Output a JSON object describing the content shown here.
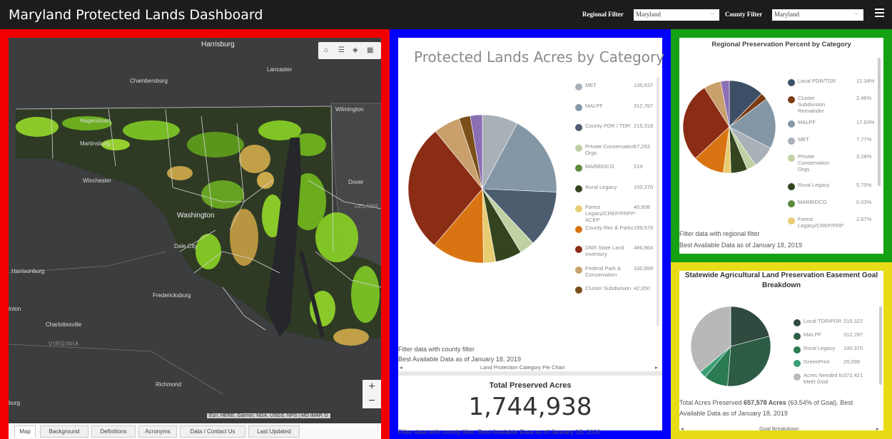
{
  "header": {
    "title": "Maryland Protected Lands Dashboard",
    "regional_filter_label": "Regional Filter",
    "regional_filter_value": "Maryland",
    "county_filter_label": "County Filter",
    "county_filter_value": "Maryland"
  },
  "colors": {
    "red_frame": "#f20000",
    "blue_frame": "#0000ff",
    "green_frame": "#14a214",
    "yellow_frame": "#e8dc16",
    "header_bg": "#1c1c1c"
  },
  "map": {
    "labels": {
      "harrisburg": "Harrisburg",
      "lancaster": "Lancaster",
      "chambersburg": "Chambersburg",
      "wilmington": "Wilmington",
      "hagerstown": "Hagerstown",
      "martinsburg": "Martinsburg",
      "winchester": "Winchester",
      "washington": "Washington",
      "dover": "Dover",
      "dale_city": "Dale City",
      "harrisonburg": "Harrisonburg",
      "fredericksburg": "Fredericksburg",
      "charlottesville": "Charlottesville",
      "virginia": "VIRGINIA",
      "richmond": "Richmond",
      "lanton": "inton",
      "burg": "burg",
      "delaware": "DELAWA"
    },
    "attribution": "Esri, HERE, Garmin, NGA, USGS, NPS | MD iMAP, D",
    "tabs": [
      "Map",
      "Background",
      "Definitions",
      "Acronyms",
      "Data / Contact Us",
      "Last Updated"
    ],
    "active_tab": "Map"
  },
  "pie1": {
    "title": "Protected Lands Acres by Category",
    "legend": [
      {
        "label": "MET",
        "value": "135,637",
        "color": "#a9b0b8"
      },
      {
        "label": "MALPF",
        "value": "312,787",
        "color": "#8497a6"
      },
      {
        "label": "County PDR / TDR",
        "value": "215,318",
        "color": "#4d5d70"
      },
      {
        "label": "Private Conservation Orgs",
        "value": "57,263",
        "color": "#bfd1a2"
      },
      {
        "label": "MARBIDCO",
        "value": "519",
        "color": "#5e8a3c"
      },
      {
        "label": "Rural Legacy",
        "value": "100,370",
        "color": "#33441e"
      },
      {
        "label": "Forest Legacy/CREP/FRPP-ACEP",
        "value": "46,608",
        "color": "#e8cc72"
      },
      {
        "label": "County Rec & Parks",
        "value": "199,576",
        "color": "#d87512"
      },
      {
        "label": "DNR State Land Inventory",
        "value": "486,864",
        "color": "#8b2c14"
      },
      {
        "label": "Federal Park & Conservation",
        "value": "100,899",
        "color": "#c9a06b"
      },
      {
        "label": "Cluster Subdivision",
        "value": "42,950",
        "color": "#7a4f1a"
      }
    ],
    "note1": "Filter data with county filter",
    "note2": "Best Available Data as of January 18, 2019",
    "nav_label": "Land Protection Category Pie Chart"
  },
  "total": {
    "title": "Total Preserved Acres",
    "value": "1,744,938",
    "note": "Filter data with county filter. Best Available Data as of January 18, 2019"
  },
  "pie2": {
    "title": "Regional Preservation Percent by Category",
    "legend": [
      {
        "label": "Local PDR/TDR",
        "value": "12.34%",
        "color": "#3d4f66"
      },
      {
        "label": "Cluster Subdivision Remainder",
        "value": "2.46%",
        "color": "#7a3a12"
      },
      {
        "label": "MALPF",
        "value": "17.93%",
        "color": "#8497a6"
      },
      {
        "label": "MET",
        "value": "7.77%",
        "color": "#a9b0b8"
      },
      {
        "label": "Private Conservation Orgs",
        "value": "3.28%",
        "color": "#bfd1a2"
      },
      {
        "label": "Rural Legacy",
        "value": "5.75%",
        "color": "#33441e"
      },
      {
        "label": "MARBIDCO",
        "value": "0.03%",
        "color": "#5e8a3c"
      },
      {
        "label": "Forest Legacy/CREP/FRP",
        "value": "2.67%",
        "color": "#e8cc72"
      }
    ],
    "note1": "Filter data with regional filter",
    "note2": "Best Available Data as of January 18, 2019"
  },
  "pie3": {
    "title": "Statewide Agricultural Land Preservation Easement Goal Breakdown",
    "legend": [
      {
        "label": "Local TDR/PDR",
        "value": "215,322",
        "color": "#2f4a3e"
      },
      {
        "label": "MALPF",
        "value": "312,787",
        "color": "#2d5c45"
      },
      {
        "label": "Rural Legacy",
        "value": "100,370",
        "color": "#2a7a52"
      },
      {
        "label": "GreenPrint",
        "value": "29,099",
        "color": "#3aa074"
      },
      {
        "label": "Acres Needed to Meet Goal",
        "value": "372,421",
        "color": "#b8b8b8"
      }
    ],
    "note_pre": "Total Acres Preserved ",
    "note_bold": "657,578 Acres",
    "note_post": " (63.54% of Goal). Best",
    "note2": "Available Data as of January 18, 2019",
    "nav_label": "Goal Breakdown"
  },
  "chart_data": [
    {
      "type": "pie",
      "title": "Protected Lands Acres by Category",
      "categories": [
        "MET",
        "MALPF",
        "County PDR / TDR",
        "Private Conservation Orgs",
        "MARBIDCO",
        "Rural Legacy",
        "Forest Legacy/CREP/FRPP-ACEP",
        "County Rec & Parks",
        "DNR State Land Inventory",
        "Federal Park & Conservation",
        "Cluster Subdivision"
      ],
      "values": [
        135637,
        312787,
        215318,
        57263,
        519,
        100370,
        46608,
        199576,
        486864,
        100899,
        42950
      ],
      "extra_slice": {
        "color": "#8a6fb5",
        "value": 46000
      },
      "legend": "right"
    },
    {
      "type": "pie",
      "title": "Regional Preservation Percent by Category",
      "categories": [
        "Local PDR/TDR",
        "Cluster Subdivision Remainder",
        "MALPF",
        "MET",
        "Private Conservation Orgs",
        "Rural Legacy",
        "MARBIDCO",
        "Forest Legacy/CREP/FRP"
      ],
      "values": [
        12.34,
        2.46,
        17.93,
        7.77,
        3.28,
        5.75,
        0.03,
        2.67
      ],
      "legend": "right"
    },
    {
      "type": "pie",
      "title": "Statewide Agricultural Land Preservation Easement Goal Breakdown",
      "categories": [
        "Local TDR/PDR",
        "MALPF",
        "Rural Legacy",
        "GreenPrint",
        "Acres Needed to Meet Goal"
      ],
      "values": [
        215322,
        312787,
        100370,
        29099,
        372421
      ],
      "legend": "right"
    }
  ]
}
